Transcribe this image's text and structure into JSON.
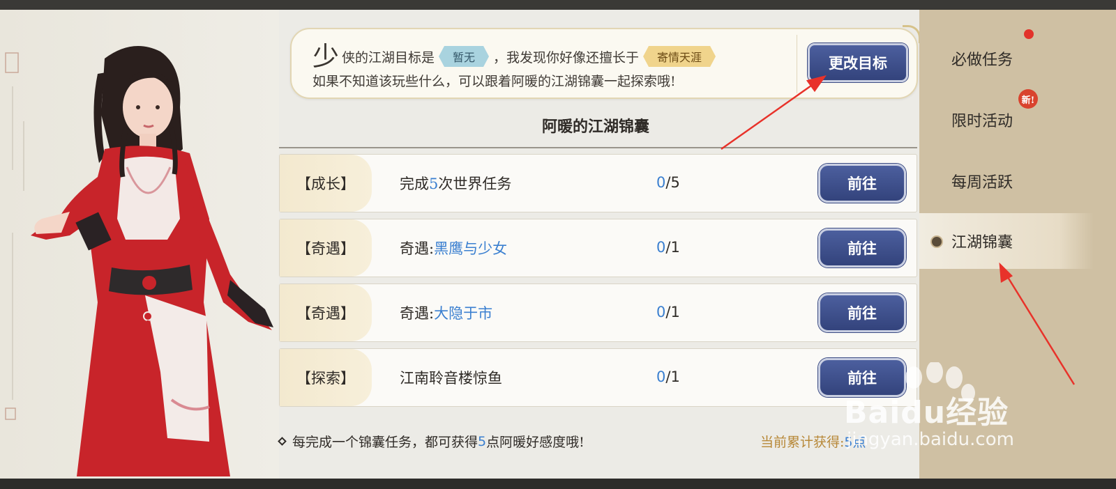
{
  "speech": {
    "big_char": "少",
    "line1_a": "侠的江湖目标是",
    "goal_tag": "暂无",
    "line1_b": "，我发现你好像还擅长于",
    "skill_tag": "寄情天涯",
    "line2": "如果不知道该玩些什么，可以跟着阿暖的江湖锦囊一起探索哦!",
    "change_button": "更改目标"
  },
  "section_title": "阿暖的江湖锦囊",
  "tasks": [
    {
      "category": "【成长】",
      "desc_pre": "完成",
      "desc_hl": "5",
      "desc_post": "次世界任务",
      "done": "0",
      "total": "/5",
      "button": "前往"
    },
    {
      "category": "【奇遇】",
      "desc_pre": "奇遇:",
      "desc_hl": "黑鹰与少女",
      "desc_post": "",
      "done": "0",
      "total": "/1",
      "button": "前往"
    },
    {
      "category": "【奇遇】",
      "desc_pre": "奇遇:",
      "desc_hl": "大隐于市",
      "desc_post": "",
      "done": "0",
      "total": "/1",
      "button": "前往"
    },
    {
      "category": "【探索】",
      "desc_pre": "江南聆音楼惊鱼",
      "desc_hl": "",
      "desc_post": "",
      "done": "0",
      "total": "/1",
      "button": "前往"
    }
  ],
  "footer": {
    "note_pre": "每完成一个锦囊任务，都可获得",
    "note_hl": "5",
    "note_post": "点阿暖好感度哦!",
    "total_label": "当前累计获得:",
    "total_value": "5点"
  },
  "sidenav": {
    "items": [
      {
        "label": "必做任务"
      },
      {
        "label": "限时活动",
        "badge": "新!"
      },
      {
        "label": "每周活跃"
      },
      {
        "label": "江湖锦囊"
      }
    ]
  },
  "watermark": {
    "brand": "Baidu经验",
    "url": "jingyan.baidu.com"
  },
  "colors": {
    "button_blue": "#3a4a82",
    "highlight_blue": "#3a7fd0",
    "gold_text": "#b78838",
    "red_dot": "#e2332b"
  }
}
